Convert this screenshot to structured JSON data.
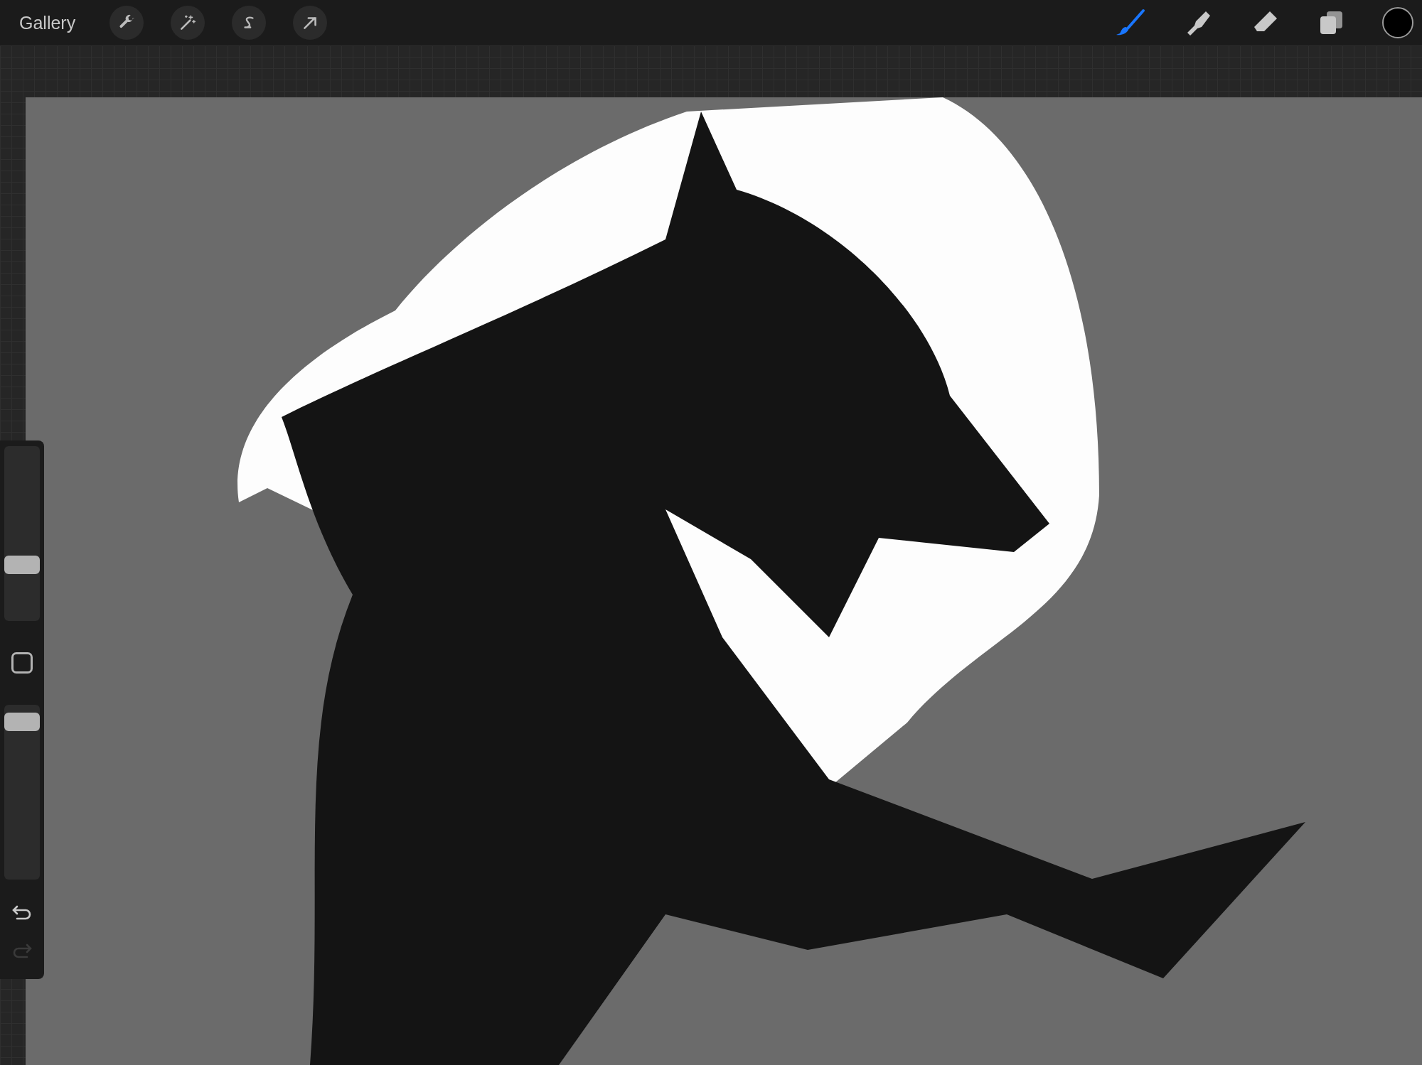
{
  "toolbar": {
    "gallery": "Gallery",
    "left_tools": [
      {
        "kind": "wrench"
      },
      {
        "kind": "wand"
      },
      {
        "kind": "selection"
      },
      {
        "kind": "transform"
      }
    ],
    "right_tools": [
      {
        "kind": "brush",
        "selected": true
      },
      {
        "kind": "smudge",
        "selected": false
      },
      {
        "kind": "eraser",
        "selected": false
      },
      {
        "kind": "layers",
        "selected": false
      }
    ],
    "color": "#000000"
  },
  "sidebar": {
    "brush_size": {
      "level": 0.3
    },
    "opacity": {
      "level": 0.95
    },
    "undo": {
      "disabled": false
    },
    "redo": {
      "disabled": true
    }
  }
}
